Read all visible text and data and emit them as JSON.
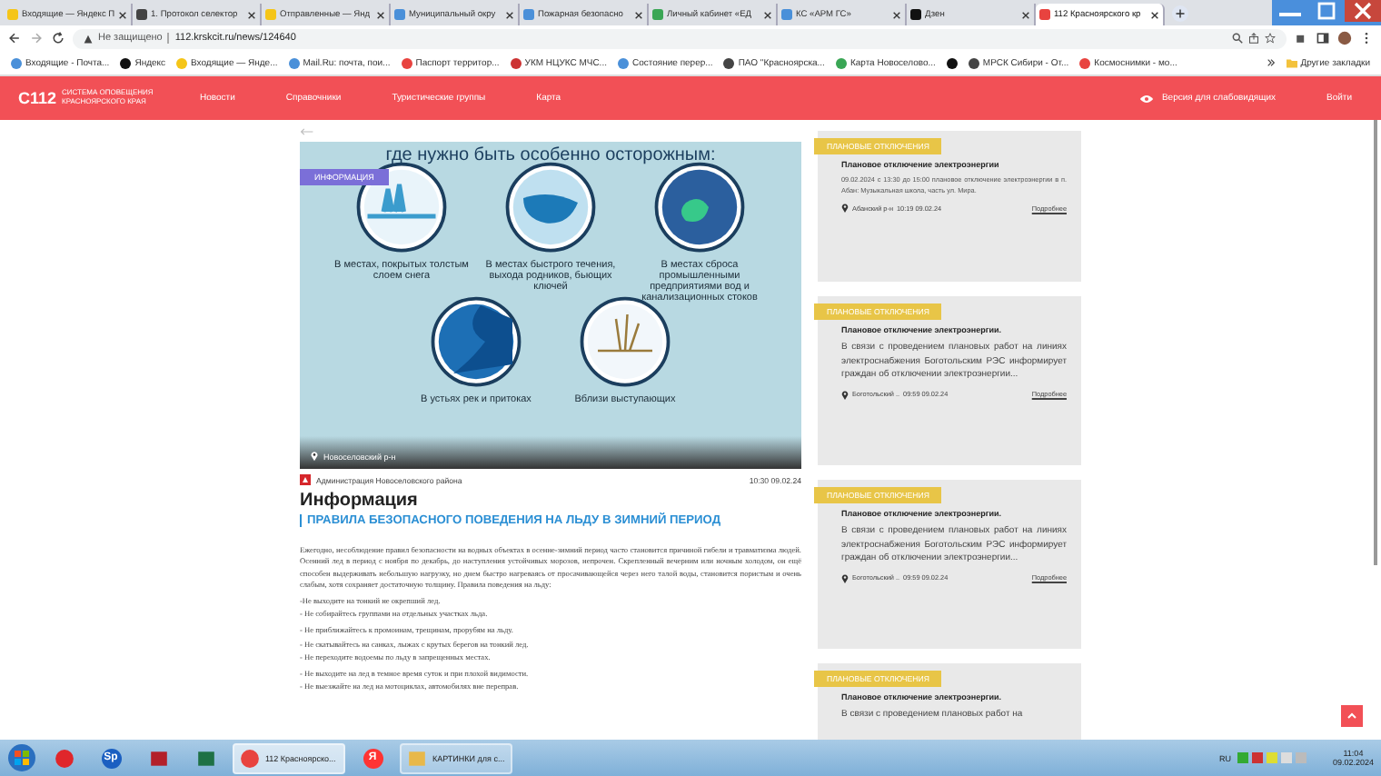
{
  "browser": {
    "tabs": [
      {
        "title": "Входящие — Яндекс П",
        "kind": "mail",
        "selected": false
      },
      {
        "title": "1. Протокол селектор",
        "kind": "globe",
        "selected": false
      },
      {
        "title": "Отправленные — Янд",
        "kind": "mail",
        "selected": false
      },
      {
        "title": "Муниципальный окру",
        "kind": "shield",
        "selected": false
      },
      {
        "title": "Пожарная безопасно",
        "kind": "shield",
        "selected": false
      },
      {
        "title": "Личный кабинет «ЕД",
        "kind": "green",
        "selected": false
      },
      {
        "title": "КС «АРМ ГС»",
        "kind": "shield",
        "selected": false
      },
      {
        "title": "Дзен",
        "kind": "dzen",
        "selected": false
      },
      {
        "title": "112 Красноярского кр",
        "kind": "site",
        "selected": true
      }
    ],
    "security": "Не защищено",
    "url": "112.krskcit.ru/news/124640",
    "bookmarks": [
      {
        "label": "Входящие - Почта...",
        "kind": "shield"
      },
      {
        "label": "Яндекс",
        "kind": "dzen"
      },
      {
        "label": "Входящие — Янде...",
        "kind": "mail"
      },
      {
        "label": "Mail.Ru: почта, пои...",
        "kind": "shield"
      },
      {
        "label": "Паспорт территор...",
        "kind": "site"
      },
      {
        "label": "УКМ НЦУКС МЧС...",
        "kind": "star"
      },
      {
        "label": "Состояние перер...",
        "kind": "shield"
      },
      {
        "label": "ПАО \"Красноярска...",
        "kind": "globe"
      },
      {
        "label": "Карта Новоселово...",
        "kind": "green"
      },
      {
        "kind": "dzen"
      },
      {
        "label": "МРСК Сибири - От...",
        "kind": "globe"
      },
      {
        "label": "Космоснимки - мо...",
        "kind": "site"
      }
    ],
    "other_bookmarks": "Другие закладки"
  },
  "header": {
    "logo_mark": "С112",
    "logo_text": "СИСТЕМА ОПОВЕЩЕНИЯ КРАСНОЯРСКОГО КРАЯ",
    "nav": [
      "Новости",
      "Справочники",
      "Туристические группы",
      "Карта"
    ],
    "accessibility": "Версия для слабовидящих",
    "login": "Войти"
  },
  "article": {
    "image": {
      "heading": "где нужно быть особенно осторожным:",
      "badge": "ИНФОРМАЦИЯ",
      "location": "Новоселовский р-н",
      "items": [
        {
          "kind": "snow",
          "caption": "В местах, покрытых толстым слоем снега"
        },
        {
          "kind": "current",
          "caption": "В местах быстрого течения, выхода родников, бьющих ключей"
        },
        {
          "kind": "drain",
          "caption": "В местах сброса промышленными предприятиями вод и канализационных стоков"
        },
        {
          "kind": "river",
          "caption": "В устьях рек и притоках"
        },
        {
          "kind": "reeds",
          "caption": "Вблизи выступающих"
        }
      ]
    },
    "source": "Администрация Новоселовского района",
    "time": "10:30 09.02.24",
    "title": "Информация",
    "subtitle": "ПРАВИЛА БЕЗОПАСНОГО ПОВЕДЕНИЯ НА ЛЬДУ В ЗИМНИЙ ПЕРИОД",
    "paragraph": "Ежегодно, несоблюдение правил безопасности на водных объектах в осенне-зимний период часто становится причиной гибели и травматизма людей. Осенний лед в период с ноября по декабрь, до наступления устойчивых морозов, непрочен. Скрепленный вечерним или ночным холодом, он ещё способен выдерживать небольшую нагрузку, но днем быстро нагреваясь от просачивающейся через него талой воды, становится пористым и очень слабым, хотя сохраняет достаточную толщину. Правила поведения на льду:",
    "rules": [
      [
        "-Не выходите на тонкий не окрепший лед.",
        "- Не собирайтесь группами на отдельных участках льда."
      ],
      [
        "- Не приближайтесь к промоинам, трещинам, прорубям на льду."
      ],
      [
        "- Не скатывайтесь на санках, лыжах с крутых берегов на тонкий лед.",
        "- Не переходите водоемы по льду в запрещенных местах."
      ],
      [
        "- Не выходите на лед в темное время суток и при плохой видимости.",
        "- Не выезжайте на лед на мотоциклах, автомобилях вне переправ."
      ]
    ]
  },
  "sidebar": [
    {
      "tag": "ПЛАНОВЫЕ ОТКЛЮЧЕНИЯ",
      "title": "Плановое отключение электроэнергии",
      "text": "09.02.2024 с 13:30 до 15:00 плановое отключение электроэнергии в п. Абан: Музыкальная школа, часть ул. Мира.",
      "location": "Абанский р-н",
      "time": "10:19 09.02.24",
      "link": "Подробнее",
      "kind": "small"
    },
    {
      "tag": "ПЛАНОВЫЕ ОТКЛЮЧЕНИЯ",
      "title": "Плановое отключение электроэнергии.",
      "text": "В связи с проведением плановых работ на линиях электроснабжения Боготольским РЭС информирует граждан об отключении электроэнергии...",
      "location": "Боготольский ..",
      "time": "09:59 09.02.24",
      "link": "Подробнее",
      "kind": "large"
    },
    {
      "tag": "ПЛАНОВЫЕ ОТКЛЮЧЕНИЯ",
      "title": "Плановое отключение электроэнергии.",
      "text": "В связи с проведением плановых работ на линиях электроснабжения Боготольским РЭС информирует граждан об отключении электроэнергии...",
      "location": "Боготольский ..",
      "time": "09:59 09.02.24",
      "link": "Подробнее",
      "kind": "large"
    },
    {
      "tag": "ПЛАНОВЫЕ ОТКЛЮЧЕНИЯ",
      "title": "Плановое отключение электроэнергии.",
      "text": "В связи с проведением плановых работ на",
      "kind": "large"
    }
  ],
  "taskbar": {
    "apps": [
      {
        "kind": "opera",
        "selected": false
      },
      {
        "kind": "sp",
        "glyph": "Sp",
        "selected": false
      },
      {
        "kind": "redapp",
        "selected": false
      },
      {
        "kind": "excel",
        "selected": false
      },
      {
        "kind": "chrome",
        "label": "112 Красноярско...",
        "selected": true
      },
      {
        "kind": "yandex",
        "glyph": "Я",
        "selected": false
      },
      {
        "kind": "folder",
        "label": "КАРТИНКИ для с...",
        "selected": false
      }
    ],
    "lang": "RU",
    "time": "11:04",
    "date": "09.02.2024"
  }
}
